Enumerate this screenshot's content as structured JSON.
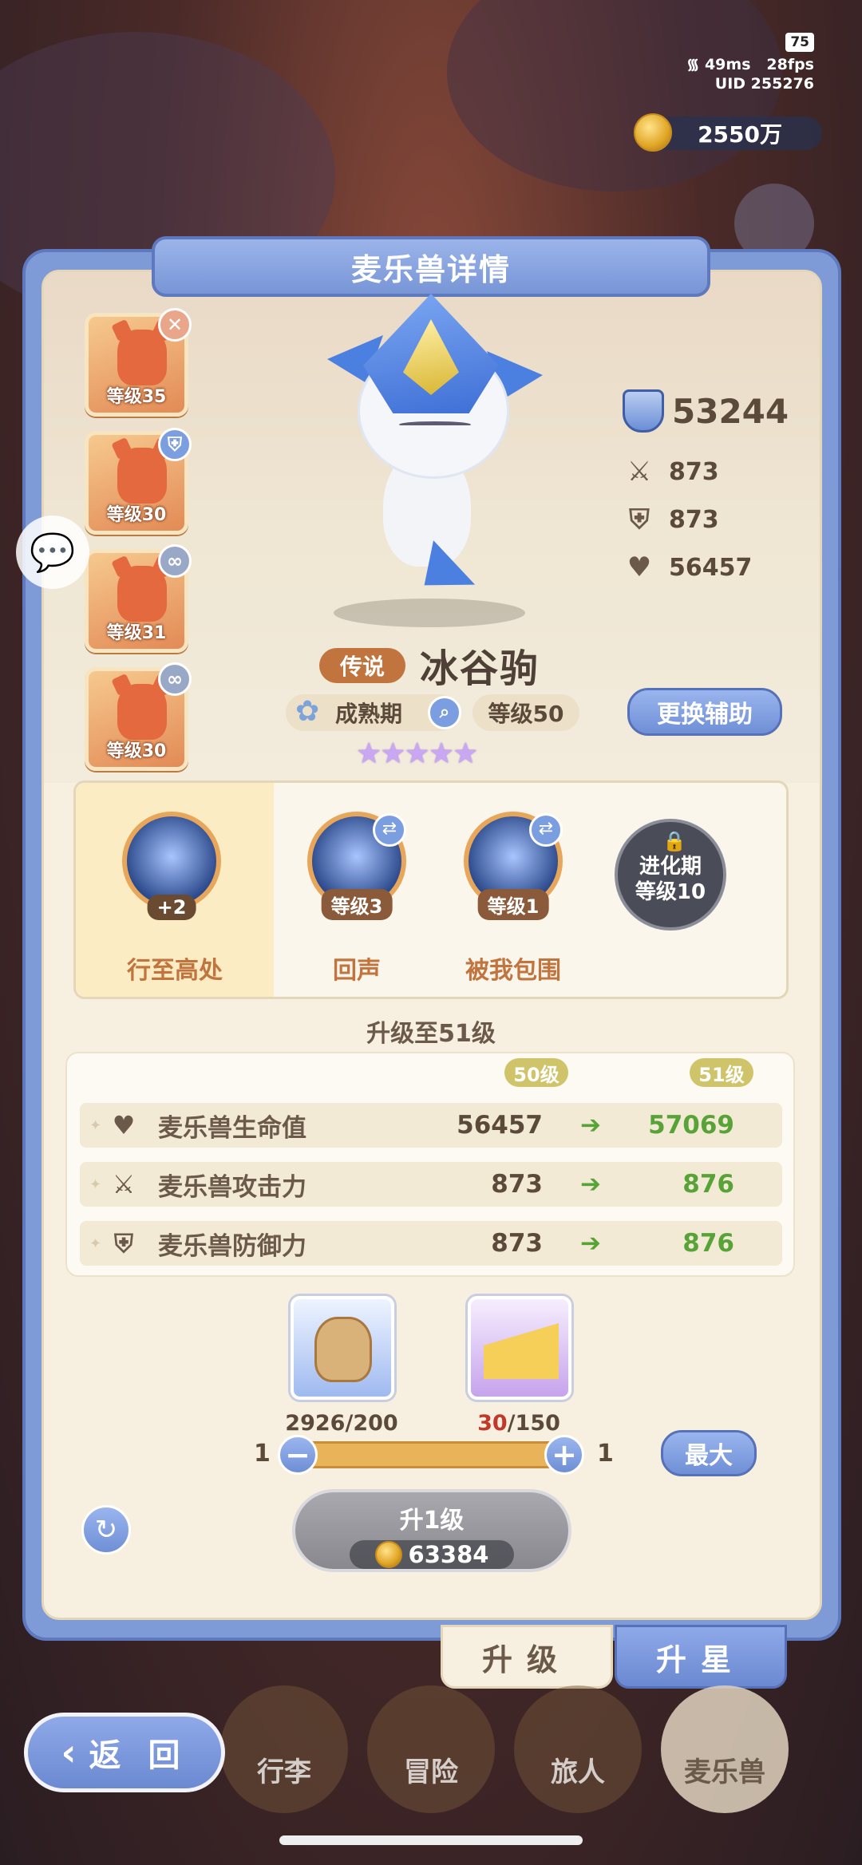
{
  "status": {
    "battery": "75",
    "ping": "49ms",
    "fps": "28fps",
    "uid": "UID 255276"
  },
  "gold": {
    "amount": "2550万"
  },
  "panel": {
    "title": "麦乐兽详情"
  },
  "team": [
    {
      "level": "等级35",
      "badge": "✕",
      "badge_color": "#e9a68a"
    },
    {
      "level": "等级30",
      "badge": "⛨",
      "badge_color": "#7a9ee0"
    },
    {
      "level": "等级31",
      "badge": "∞",
      "badge_color": "#9aa8c8"
    },
    {
      "level": "等级30",
      "badge": "∞",
      "badge_color": "#9aa8c8"
    }
  ],
  "pet": {
    "rarity": "传说",
    "name": "冰谷驹",
    "stage": "成熟期",
    "level": "等级50",
    "stars": "★★★★★",
    "power": "53244",
    "attack": "873",
    "defense": "873",
    "hp": "56457"
  },
  "buttons": {
    "change_assist": "更换辅助",
    "max": "最大",
    "upgrade": "升1级",
    "back": "返 回"
  },
  "skills": [
    {
      "name": "行至高处",
      "tag": "+2"
    },
    {
      "name": "回声",
      "tag": "等级3"
    },
    {
      "name": "被我包围",
      "tag": "等级1"
    }
  ],
  "locked_skill": {
    "line1": "进化期",
    "line2": "等级10"
  },
  "upgrade": {
    "title": "升级至51级",
    "from_level": "50级",
    "to_level": "51级",
    "rows": [
      {
        "label": "麦乐兽生命值",
        "old": "56457",
        "new": "57069"
      },
      {
        "label": "麦乐兽攻击力",
        "old": "873",
        "new": "876"
      },
      {
        "label": "麦乐兽防御力",
        "old": "873",
        "new": "876"
      }
    ],
    "cost": "63384"
  },
  "materials": [
    {
      "have": "2926",
      "need": "/200"
    },
    {
      "have": "30",
      "need": "/150"
    }
  ],
  "slider": {
    "min": "1",
    "max": "1",
    "value": 1
  },
  "tabs": {
    "level": "升级",
    "star": "升星"
  },
  "nav": {
    "bag": "行李",
    "adventure": "冒险",
    "traveler": "旅人",
    "pets": "麦乐兽"
  },
  "colors": {
    "accent": "#7e9bd8",
    "gain": "#58a338",
    "warn": "#c0392b"
  }
}
